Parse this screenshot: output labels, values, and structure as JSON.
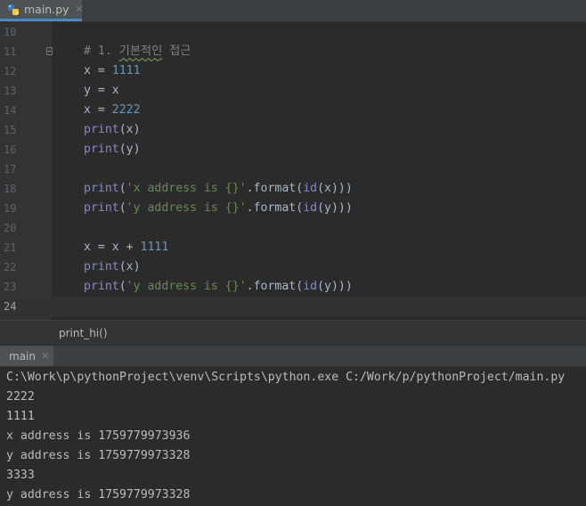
{
  "editor_tab": {
    "filename": "main.py",
    "close_glyph": "✕",
    "icon": "python-file-icon"
  },
  "lines": [
    {
      "num": "10",
      "tokens": []
    },
    {
      "num": "11",
      "tokens": [
        {
          "t": "comment",
          "v": "# 1. "
        },
        {
          "t": "comment-squiggle",
          "v": "기본적인"
        },
        {
          "t": "comment",
          "v": " 접근"
        }
      ]
    },
    {
      "num": "12",
      "tokens": [
        {
          "t": "text",
          "v": "x = "
        },
        {
          "t": "num",
          "v": "1111"
        }
      ]
    },
    {
      "num": "13",
      "tokens": [
        {
          "t": "text",
          "v": "y = x"
        }
      ]
    },
    {
      "num": "14",
      "tokens": [
        {
          "t": "text",
          "v": "x = "
        },
        {
          "t": "num",
          "v": "2222"
        }
      ]
    },
    {
      "num": "15",
      "tokens": [
        {
          "t": "builtin",
          "v": "print"
        },
        {
          "t": "text",
          "v": "(x)"
        }
      ]
    },
    {
      "num": "16",
      "tokens": [
        {
          "t": "builtin",
          "v": "print"
        },
        {
          "t": "text",
          "v": "(y)"
        }
      ]
    },
    {
      "num": "17",
      "tokens": []
    },
    {
      "num": "18",
      "tokens": [
        {
          "t": "builtin",
          "v": "print"
        },
        {
          "t": "text",
          "v": "("
        },
        {
          "t": "str",
          "v": "'x address is {}'"
        },
        {
          "t": "text",
          "v": "."
        },
        {
          "t": "text",
          "v": "format"
        },
        {
          "t": "text",
          "v": "("
        },
        {
          "t": "builtin",
          "v": "id"
        },
        {
          "t": "text",
          "v": "(x)))"
        }
      ]
    },
    {
      "num": "19",
      "tokens": [
        {
          "t": "builtin",
          "v": "print"
        },
        {
          "t": "text",
          "v": "("
        },
        {
          "t": "str",
          "v": "'y address is {}'"
        },
        {
          "t": "text",
          "v": "."
        },
        {
          "t": "text",
          "v": "format"
        },
        {
          "t": "text",
          "v": "("
        },
        {
          "t": "builtin",
          "v": "id"
        },
        {
          "t": "text",
          "v": "(y)))"
        }
      ]
    },
    {
      "num": "20",
      "tokens": []
    },
    {
      "num": "21",
      "tokens": [
        {
          "t": "text",
          "v": "x = x + "
        },
        {
          "t": "num",
          "v": "1111"
        }
      ]
    },
    {
      "num": "22",
      "tokens": [
        {
          "t": "builtin",
          "v": "print"
        },
        {
          "t": "text",
          "v": "(x)"
        }
      ]
    },
    {
      "num": "23",
      "tokens": [
        {
          "t": "builtin",
          "v": "print"
        },
        {
          "t": "text",
          "v": "("
        },
        {
          "t": "str",
          "v": "'y address is {}'"
        },
        {
          "t": "text",
          "v": "."
        },
        {
          "t": "text",
          "v": "format"
        },
        {
          "t": "text",
          "v": "("
        },
        {
          "t": "builtin",
          "v": "id"
        },
        {
          "t": "text",
          "v": "(y)))"
        }
      ]
    },
    {
      "num": "24",
      "tokens": [],
      "current": true
    }
  ],
  "breadcrumb": {
    "text": "print_hi()"
  },
  "run_tab": {
    "label": "main",
    "close_glyph": "✕"
  },
  "console": [
    "C:\\Work\\p\\pythonProject\\venv\\Scripts\\python.exe C:/Work/p/pythonProject/main.py",
    "2222",
    "1111",
    "x address is 1759779973936",
    "y address is 1759779973328",
    "3333",
    "y address is 1759779973328"
  ],
  "colors": {
    "background": "#2b2b2b",
    "comment": "#808080",
    "number": "#6897bb",
    "builtin": "#8888c6",
    "string": "#6a8759",
    "tab_underline": "#4a88c7"
  }
}
